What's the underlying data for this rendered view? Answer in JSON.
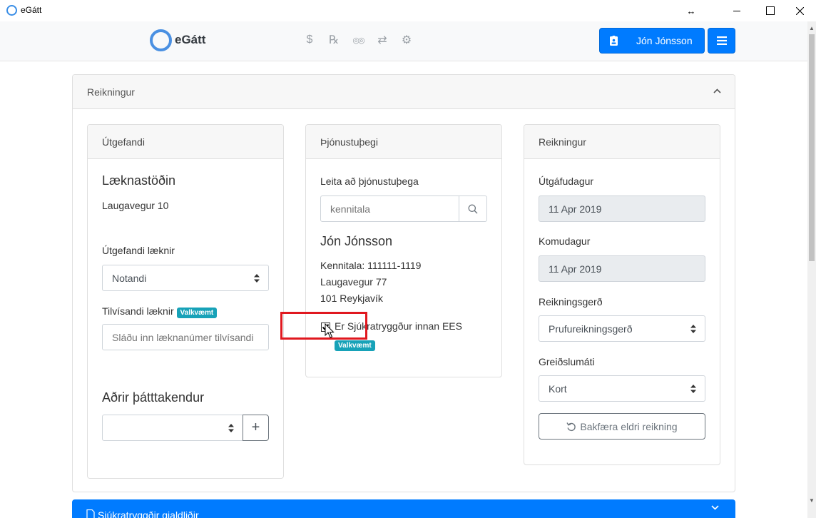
{
  "window": {
    "title": "eGátt"
  },
  "navbar": {
    "brand": "eGátt",
    "icons": [
      "dollar-icon",
      "prescription-icon",
      "glasses-icon",
      "transfer-icon",
      "settings-icon"
    ],
    "icon_glyphs": [
      "$",
      "℞",
      "◎◎",
      "⇄",
      "⚙"
    ],
    "user_name": "Jón Jónsson"
  },
  "main_card": {
    "title": "Reikningur",
    "issuer": {
      "title": "Útgefandi",
      "clinic_name": "Læknastöðin",
      "clinic_address": "Laugavegur 10",
      "doctor_label": "Útgefandi læknir",
      "doctor_value": "Notandi",
      "referring_label": "Tilvísandi læknir",
      "optional_badge": "Valkvæmt",
      "referring_placeholder": "Sláðu inn læknanúmer tilvísandi",
      "participants_heading": "Aðrir þátttakendur",
      "participants_value": "",
      "add_symbol": "+"
    },
    "recipient": {
      "title": "Þjónustuþegi",
      "search_label": "Leita að þjónustuþega",
      "search_placeholder": "kennitala",
      "name": "Jón Jónsson",
      "kennitala": "Kennitala: 111111-1119",
      "address_line1": "Laugavegur 77",
      "address_line2": "101 Reykjavík",
      "insurance_checkbox_label": "Er Sjúkratryggður innan EES",
      "insurance_checked": true,
      "optional_badge": "Valkvæmt"
    },
    "invoice": {
      "title": "Reikningur",
      "issue_date_label": "Útgáfudagur",
      "issue_date_value": "11 Apr 2019",
      "arrival_date_label": "Komudagur",
      "arrival_date_value": "11 Apr 2019",
      "invoice_type_label": "Reikningsgerð",
      "invoice_type_value": "Prufureikningsgerð",
      "payment_method_label": "Greiðslumáti",
      "payment_method_value": "Kort",
      "reverse_button": "Bakfæra eldri reikning"
    }
  },
  "second_card": {
    "title": "Sjúkratryggðir gjaldliðir"
  },
  "colors": {
    "primary": "#007bff",
    "highlight": "#e0181f",
    "badge": "#17a2b8"
  }
}
